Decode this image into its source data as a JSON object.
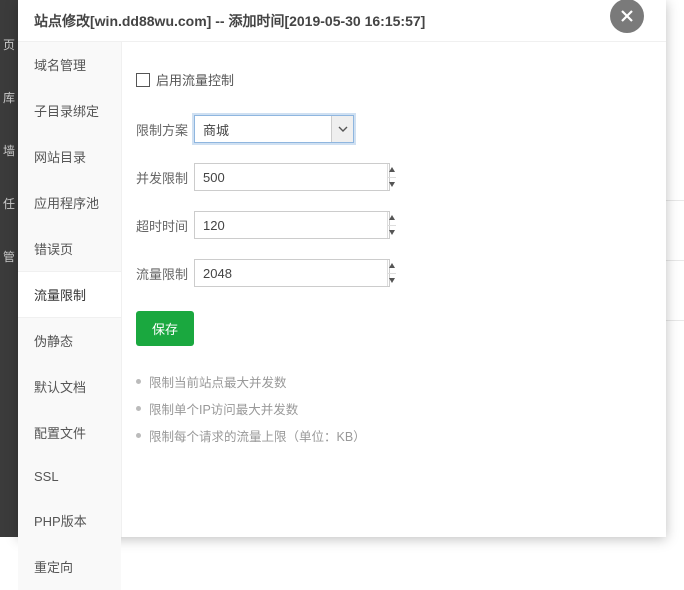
{
  "bg_nav": [
    "页",
    "库",
    "",
    "墙",
    "",
    "任",
    "",
    "管",
    "",
    "",
    ""
  ],
  "modal_title": "站点修改[win.dd88wu.com] -- 添加时间[2019-05-30 16:15:57]",
  "sidebar": {
    "items": [
      {
        "label": "域名管理"
      },
      {
        "label": "子目录绑定"
      },
      {
        "label": "网站目录"
      },
      {
        "label": "应用程序池"
      },
      {
        "label": "错误页"
      },
      {
        "label": "流量限制"
      },
      {
        "label": "伪静态"
      },
      {
        "label": "默认文档"
      },
      {
        "label": "配置文件"
      },
      {
        "label": "SSL"
      },
      {
        "label": "PHP版本"
      },
      {
        "label": "重定向"
      }
    ]
  },
  "content": {
    "enable_label": "启用流量控制",
    "enable_checked": false,
    "scheme_label": "限制方案",
    "scheme_selected": "商城",
    "concurrency_label": "并发限制",
    "concurrency_value": "500",
    "timeout_label": "超时时间",
    "timeout_value": "120",
    "traffic_label": "流量限制",
    "traffic_value": "2048",
    "save_label": "保存",
    "hints": [
      "限制当前站点最大并发数",
      "限制单个IP访问最大并发数",
      "限制每个请求的流量上限（单位：KB）"
    ]
  }
}
